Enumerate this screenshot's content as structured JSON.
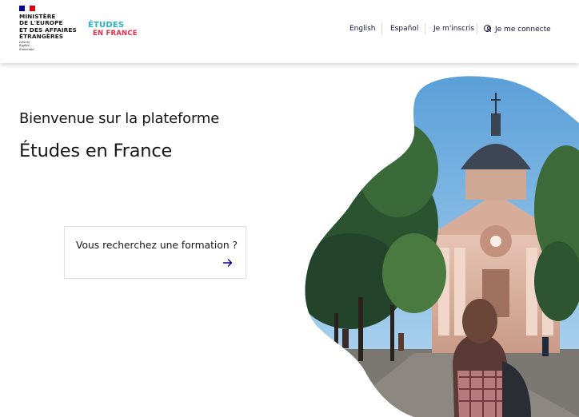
{
  "header": {
    "ministry_lines": [
      "MINISTÈRE",
      "DE L'EUROPE",
      "ET DES AFFAIRES",
      "ÉTRANGÈRES"
    ],
    "motto_lines": [
      "Liberté",
      "Égalité",
      "Fraternité"
    ],
    "logo_line1": "ÉTUDES",
    "logo_line2": "EN FRANCE"
  },
  "nav": {
    "english": "English",
    "espanol": "Español",
    "register": "Je m'inscris",
    "login": "Je me connecte"
  },
  "hero": {
    "welcome": "Bienvenue sur la plateforme",
    "title": "Études en France",
    "search_card_label": "Vous recherchez une formation ?"
  },
  "colors": {
    "brand_blue": "#000091",
    "brand_red": "#e1000f",
    "logo_teal": "#23b5c8",
    "logo_red": "#ea2d4a",
    "nav_text": "#161640"
  },
  "icons": {
    "user": "user-circle-icon",
    "arrow": "arrow-right-icon"
  }
}
